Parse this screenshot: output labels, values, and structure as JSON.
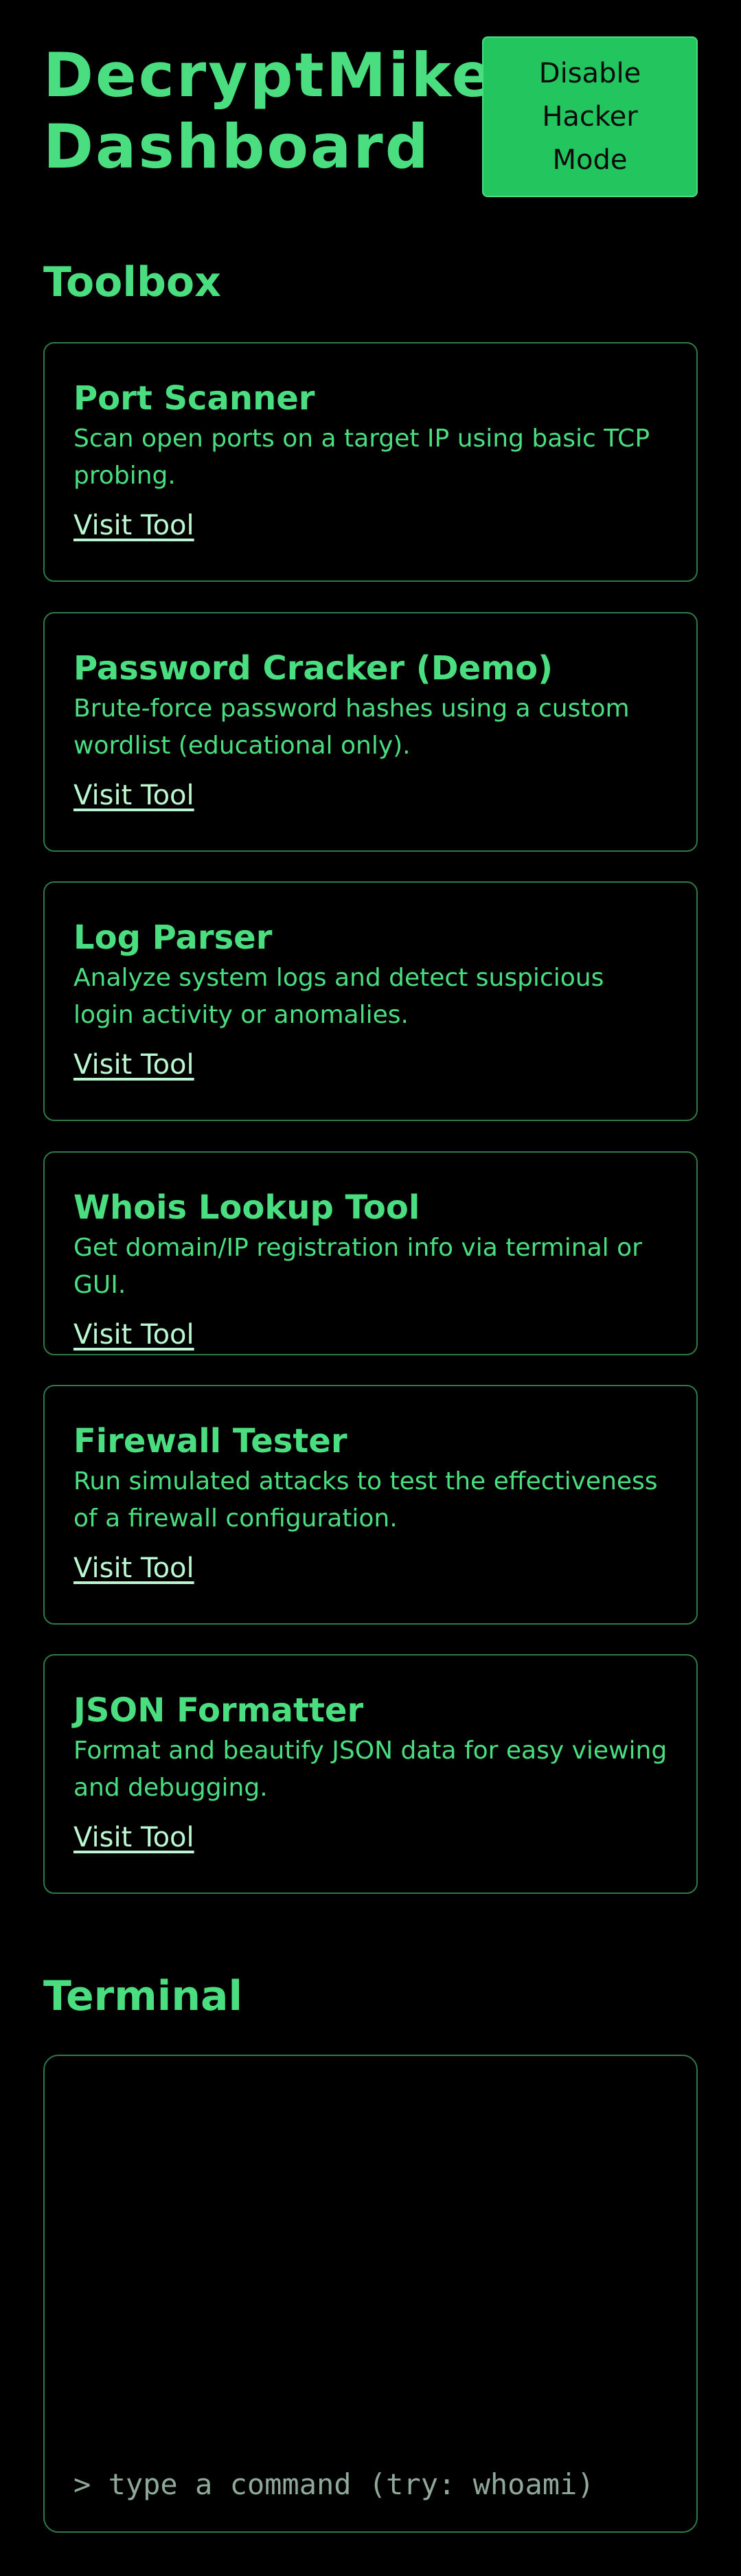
{
  "header": {
    "title": "DecryptMike Dashboard",
    "hacker_button_label": "Disable Hacker Mode"
  },
  "toolbox": {
    "heading": "Toolbox",
    "link_label": "Visit Tool",
    "tools": [
      {
        "name": "Port Scanner",
        "description": "Scan open ports on a target IP using basic TCP probing."
      },
      {
        "name": "Password Cracker (Demo)",
        "description": "Brute-force password hashes using a custom wordlist (educational only)."
      },
      {
        "name": "Log Parser",
        "description": "Analyze system logs and detect suspicious login activity or anomalies."
      },
      {
        "name": "Whois Lookup Tool",
        "description": "Get domain/IP registration info via terminal or GUI."
      },
      {
        "name": "Firewall Tester",
        "description": "Run simulated attacks to test the effectiveness of a firewall configuration."
      },
      {
        "name": "JSON Formatter",
        "description": "Format and beautify JSON data for easy viewing and debugging."
      }
    ]
  },
  "terminal": {
    "heading": "Terminal",
    "input_value": "",
    "input_placeholder": "> type a command (try: whoami)"
  },
  "colors": {
    "background": "#000000",
    "accent_green": "#4ade80",
    "button_green": "#22c55e",
    "border_green": "#2f7a47",
    "link_green": "#bbf7d0"
  }
}
